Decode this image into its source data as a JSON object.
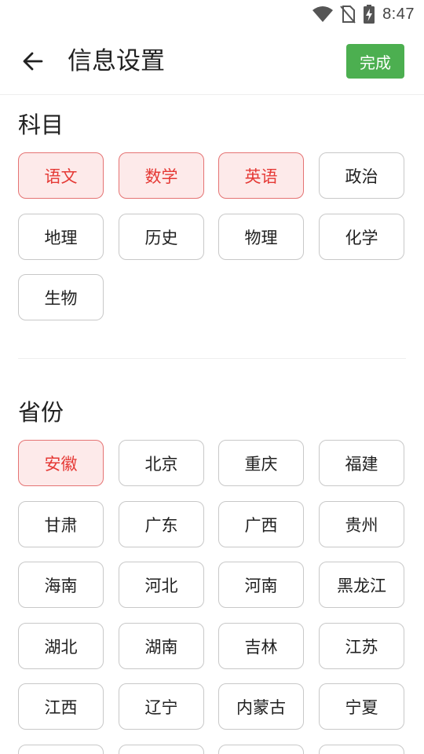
{
  "status_bar": {
    "time": "8:47",
    "icons": [
      "wifi-icon",
      "no-sim-icon",
      "battery-charging-icon"
    ]
  },
  "header": {
    "back_icon": "arrow-left-icon",
    "title": "信息设置",
    "done_label": "完成",
    "done_color": "#4caf50"
  },
  "colors": {
    "selected_text": "#e53935",
    "selected_border": "#e57373",
    "selected_background": "#fdeaea",
    "chip_border": "#c8c8c8"
  },
  "subjects": {
    "title": "科目",
    "items": [
      {
        "label": "语文",
        "selected": true
      },
      {
        "label": "数学",
        "selected": true
      },
      {
        "label": "英语",
        "selected": true
      },
      {
        "label": "政治",
        "selected": false
      },
      {
        "label": "地理",
        "selected": false
      },
      {
        "label": "历史",
        "selected": false
      },
      {
        "label": "物理",
        "selected": false
      },
      {
        "label": "化学",
        "selected": false
      },
      {
        "label": "生物",
        "selected": false
      }
    ]
  },
  "provinces": {
    "title": "省份",
    "items": [
      {
        "label": "安徽",
        "selected": true
      },
      {
        "label": "北京",
        "selected": false
      },
      {
        "label": "重庆",
        "selected": false
      },
      {
        "label": "福建",
        "selected": false
      },
      {
        "label": "甘肃",
        "selected": false
      },
      {
        "label": "广东",
        "selected": false
      },
      {
        "label": "广西",
        "selected": false
      },
      {
        "label": "贵州",
        "selected": false
      },
      {
        "label": "海南",
        "selected": false
      },
      {
        "label": "河北",
        "selected": false
      },
      {
        "label": "河南",
        "selected": false
      },
      {
        "label": "黑龙江",
        "selected": false
      },
      {
        "label": "湖北",
        "selected": false
      },
      {
        "label": "湖南",
        "selected": false
      },
      {
        "label": "吉林",
        "selected": false
      },
      {
        "label": "江苏",
        "selected": false
      },
      {
        "label": "江西",
        "selected": false
      },
      {
        "label": "辽宁",
        "selected": false
      },
      {
        "label": "内蒙古",
        "selected": false
      },
      {
        "label": "宁夏",
        "selected": false
      },
      {
        "label": "",
        "selected": false
      },
      {
        "label": "",
        "selected": false
      },
      {
        "label": "",
        "selected": false
      },
      {
        "label": "",
        "selected": false
      }
    ]
  }
}
